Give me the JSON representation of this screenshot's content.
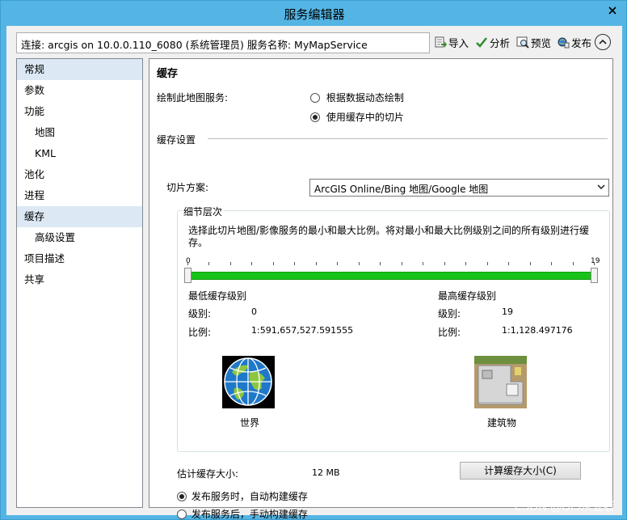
{
  "window": {
    "title": "服务编辑器"
  },
  "toolbar": {
    "connection": "连接: arcgis on 10.0.0.110_6080 (系统管理员)   服务名称: MyMapService",
    "import_label": "导入",
    "analyze_label": "分析",
    "preview_label": "预览",
    "publish_label": "发布"
  },
  "sidebar": {
    "items": [
      {
        "label": "常规",
        "sub": false,
        "selected": true
      },
      {
        "label": "参数",
        "sub": false,
        "selected": false
      },
      {
        "label": "功能",
        "sub": false,
        "selected": false
      },
      {
        "label": "地图",
        "sub": true,
        "selected": false
      },
      {
        "label": "KML",
        "sub": true,
        "selected": false
      },
      {
        "label": "池化",
        "sub": false,
        "selected": false
      },
      {
        "label": "进程",
        "sub": false,
        "selected": false
      },
      {
        "label": "缓存",
        "sub": false,
        "selected": true
      },
      {
        "label": "高级设置",
        "sub": true,
        "selected": false
      },
      {
        "label": "项目描述",
        "sub": false,
        "selected": false
      },
      {
        "label": "共享",
        "sub": false,
        "selected": false
      }
    ]
  },
  "main": {
    "heading": "缓存",
    "draw_label": "绘制此地图服务:",
    "draw_option_dynamic": "根据数据动态绘制",
    "draw_option_cache": "使用缓存中的切片",
    "cache_settings_label": "缓存设置",
    "tiling_scheme_label": "切片方案:",
    "tiling_scheme_value": "ArcGIS Online/Bing 地图/Google 地图",
    "lod_group_label": "细节层次",
    "lod_description": "选择此切片地图/影像服务的最小和最大比例。将对最小和最大比例级别之间的所有级别进行缓存。",
    "slider_min_label": "0",
    "slider_max_label": "19",
    "slider_min": 0,
    "slider_max": 19,
    "min_level_heading": "最低缓存级别",
    "max_level_heading": "最高缓存级别",
    "level_label": "级别:",
    "scale_label": "比例:",
    "min_level_value": "0",
    "min_scale_value": "1:591,657,527.591555",
    "max_level_value": "19",
    "max_scale_value": "1:1,128.497176",
    "world_caption": "世界",
    "building_caption": "建筑物",
    "estimate_label": "估计缓存大小:",
    "estimate_value": "12 MB",
    "calc_button": "计算缓存大小(C)",
    "build_auto": "发布服务时，自动构建缓存",
    "build_manual": "发布服务后，手动构建缓存"
  },
  "watermark": "CSDN @GIS从业者"
}
